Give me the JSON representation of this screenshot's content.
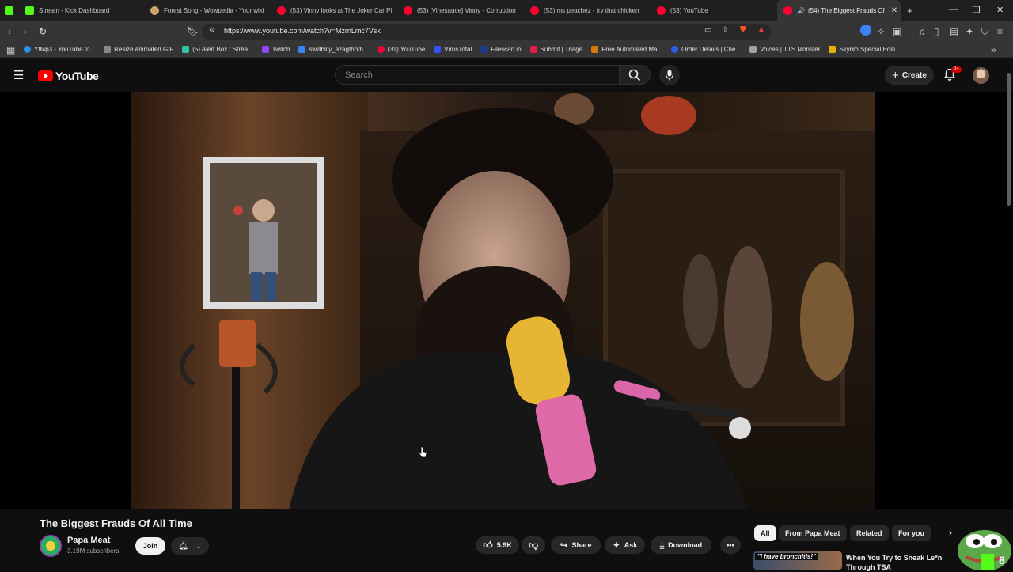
{
  "browser": {
    "tabs": [
      {
        "label": "",
        "color": "#53fc18"
      },
      {
        "label": "Stream - Kick Dashboard",
        "color": "#53fc18"
      },
      {
        "label": "Forest Song - Wowpedia - Your wiki",
        "color": "#c9a36a"
      },
      {
        "label": "(53) Vinny looks at The Joker Car Pl",
        "color": "#ff0033"
      },
      {
        "label": "(53) [Vinesauce] Vinny - Corruption",
        "color": "#ff0033"
      },
      {
        "label": "(53) ms peachez - fry that chicken",
        "color": "#ff0033"
      },
      {
        "label": "(53) YouTube",
        "color": "#ff0033"
      },
      {
        "label": "(54) The Biggest Frauds Of",
        "color": "#ff0033"
      }
    ],
    "url": "https://www.youtube.com/watch?v=MzrnLmc7Vsk",
    "bookmarks": [
      {
        "label": "YtMp3 - YouTube to...",
        "color": "#2d8cf0"
      },
      {
        "label": "Resize animated GIF",
        "color": "#888888"
      },
      {
        "label": "(5) Alert Box / Strea...",
        "color": "#31c3a2"
      },
      {
        "label": "Twitch",
        "color": "#9146ff"
      },
      {
        "label": "swillbilly_azagthoth...",
        "color": "#3b82f6"
      },
      {
        "label": "(31) YouTube",
        "color": "#ff0033"
      },
      {
        "label": "VirusTotal",
        "color": "#394eff"
      },
      {
        "label": "Filescan.io",
        "color": "#1e3a8a"
      },
      {
        "label": "Submit | Triage",
        "color": "#e11d48"
      },
      {
        "label": "Free Automated Ma...",
        "color": "#d97706"
      },
      {
        "label": "Order Details | Che...",
        "color": "#2563eb"
      },
      {
        "label": "Voices | TTS.Monster",
        "color": "#a3a3a3"
      },
      {
        "label": "Skyrim Special Editi...",
        "color": "#eab308"
      }
    ]
  },
  "youtube": {
    "logo_text": "YouTube",
    "search_placeholder": "Search",
    "create_label": "Create",
    "notifications_badge": "9+",
    "video_title": "The Biggest Frauds Of All Time",
    "channel_name": "Papa Meat",
    "subscribers": "3.19M subscribers",
    "join_label": "Join",
    "like_count": "5.9K",
    "share_label": "Share",
    "ask_label": "Ask",
    "download_label": "Download",
    "chips": [
      "All",
      "From Papa Meat",
      "Related",
      "For you"
    ],
    "recommended": {
      "thumb_text": "\"i have bronchitis!\"",
      "title": "When You Try to Sneak Le*n Through TSA"
    },
    "overlay_number": "8"
  }
}
